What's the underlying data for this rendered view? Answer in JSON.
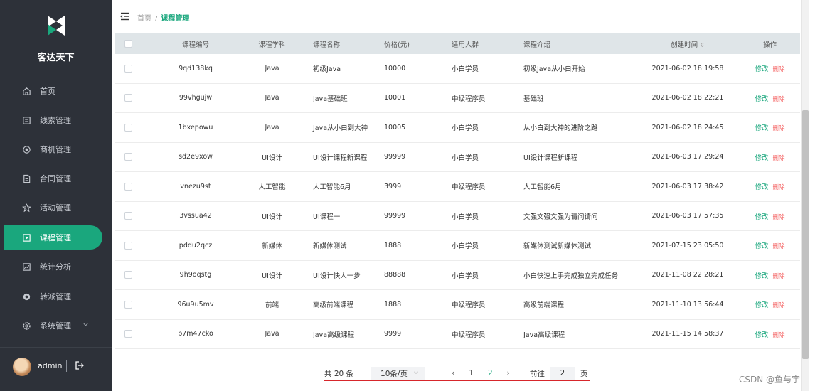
{
  "app": {
    "name": "客达天下"
  },
  "sidebar": {
    "items": [
      {
        "label": "首页",
        "icon": "home-icon"
      },
      {
        "label": "线索管理",
        "icon": "clue-icon"
      },
      {
        "label": "商机管理",
        "icon": "target-icon"
      },
      {
        "label": "合同管理",
        "icon": "contract-icon"
      },
      {
        "label": "活动管理",
        "icon": "activity-icon"
      },
      {
        "label": "课程管理",
        "icon": "course-icon",
        "active": true
      },
      {
        "label": "统计分析",
        "icon": "chart-icon"
      },
      {
        "label": "转派管理",
        "icon": "transfer-icon"
      },
      {
        "label": "系统管理",
        "icon": "system-gear-icon"
      }
    ],
    "user": "admin"
  },
  "breadcrumb": {
    "home": "首页",
    "sep": "/",
    "current": "课程管理"
  },
  "table": {
    "headers": [
      "课程编号",
      "课程学科",
      "课程名称",
      "价格(元)",
      "适用人群",
      "课程介绍",
      "创建时间",
      "操作"
    ],
    "sort_icon": "⇕",
    "edit_label": "修改",
    "delete_label": "删除",
    "rows": [
      [
        "9qd138kq",
        "Java",
        "初级Java",
        "10000",
        "小白学员",
        "初级Java从小白开始",
        "2021-06-02 18:19:58"
      ],
      [
        "99vhgujw",
        "Java",
        "Java基础班",
        "10001",
        "中级程序员",
        "基础班",
        "2021-06-02 18:22:21"
      ],
      [
        "1bxepowu",
        "Java",
        "Java从小白到大神",
        "10005",
        "小白学员",
        "从小白到大神的进阶之路",
        "2021-06-02 18:24:45"
      ],
      [
        "sd2e9xow",
        "UI设计",
        "UI设计课程新课程",
        "99999",
        "小白学员",
        "UI设计课程新课程",
        "2021-06-03 17:29:24"
      ],
      [
        "vnezu9st",
        "人工智能",
        "人工智能6月",
        "3999",
        "中级程序员",
        "人工智能6月",
        "2021-06-03 17:38:42"
      ],
      [
        "3vssua42",
        "UI设计",
        "UI课程一",
        "99999",
        "小白学员",
        "文强文强文强为请问请问",
        "2021-06-03 17:57:35"
      ],
      [
        "pddu2qcz",
        "新媒体",
        "新媒体测试",
        "1888",
        "小白学员",
        "新媒体测试新媒体测试",
        "2021-07-15 23:05:50"
      ],
      [
        "9h9oqstg",
        "UI设计",
        "UI设计快人一步",
        "88888",
        "小白学员",
        "小白快速上手完成独立完成任务",
        "2021-11-08 22:28:21"
      ],
      [
        "96u9u5mv",
        "前端",
        "高级前端课程",
        "1888",
        "中级程序员",
        "高级前端课程",
        "2021-11-10 13:56:44"
      ],
      [
        "p7m47cko",
        "Java",
        "Java高级课程",
        "9999",
        "中级程序员",
        "Java高级课程",
        "2021-11-15 14:58:37"
      ]
    ]
  },
  "pager": {
    "total": "共 20 条",
    "page_size": "10条/页",
    "prev": "‹",
    "pages": [
      "1",
      "2"
    ],
    "current_page": "2",
    "next": "›",
    "goto_label": "前往",
    "goto_value": "2",
    "page_unit": "页"
  },
  "watermark": "CSDN @鱼与宇",
  "colors": {
    "sidebar_bg": "#2d3139",
    "accent": "#1aa77d",
    "danger": "#f56c6c",
    "header_bg": "#dfe5e8"
  }
}
